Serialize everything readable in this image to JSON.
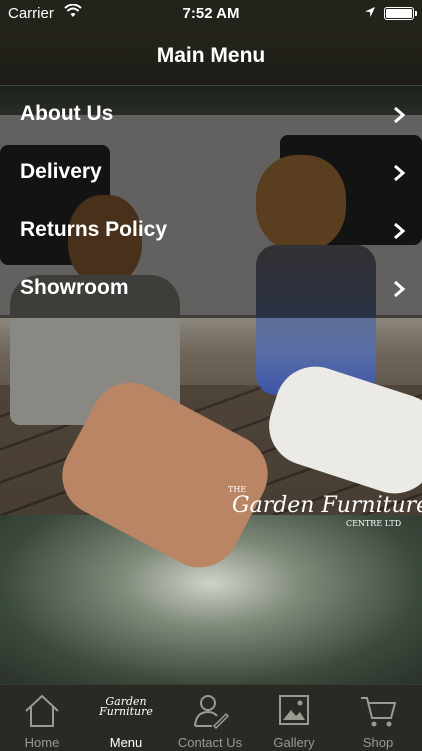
{
  "status_bar": {
    "carrier": "Carrier",
    "time": "7:52 AM"
  },
  "nav": {
    "title": "Main Menu"
  },
  "menu": {
    "items": [
      {
        "label": "About Us"
      },
      {
        "label": "Delivery"
      },
      {
        "label": "Returns Policy"
      },
      {
        "label": "Showroom"
      }
    ]
  },
  "logo": {
    "the": "THE",
    "main": "Garden Furniture",
    "ltd": "CENTRE LTD"
  },
  "tabs": [
    {
      "label": "Home",
      "icon": "home-icon"
    },
    {
      "label": "Menu",
      "icon": "menu-logo-icon"
    },
    {
      "label": "Contact Us",
      "icon": "contact-icon"
    },
    {
      "label": "Gallery",
      "icon": "gallery-icon"
    },
    {
      "label": "Shop",
      "icon": "cart-icon"
    }
  ],
  "tab_logo_text": "Garden Furniture",
  "colors": {
    "nav_bg": "#1d1c16",
    "tab_active": "#ffffff",
    "tab_inactive": "#9a9a92"
  }
}
